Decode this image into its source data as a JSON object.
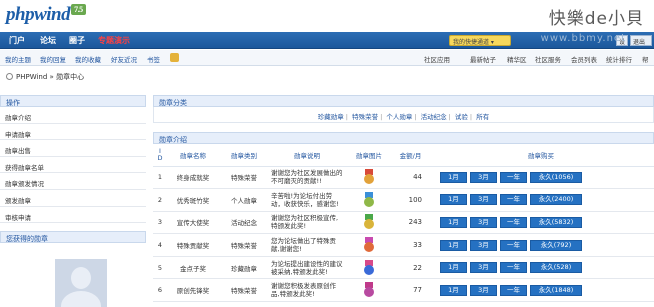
{
  "header": {
    "logo": "phpwind",
    "logo_version": "7.5",
    "watermark": "快樂de小貝",
    "watermark_url": "www.bbmy.net"
  },
  "nav": {
    "items": [
      {
        "label": "门户",
        "color": "#ffffff"
      },
      {
        "label": "论坛",
        "color": "#ffffff"
      },
      {
        "label": "圈子",
        "color": "#ffffff"
      },
      {
        "label": "专题演示",
        "color": "#ff4040"
      }
    ],
    "quick_link": "我的快捷通道 ▾",
    "box1": "设",
    "box2": "退出"
  },
  "subnav": {
    "left": [
      "我的主题",
      "我的回复",
      "我的收藏",
      "好友近况",
      "书签"
    ],
    "right": [
      "社区应用",
      "最新帖子",
      "精华区",
      "社区服务",
      "会员列表",
      "统计排行",
      "帮"
    ]
  },
  "breadcrumb": {
    "site": "PHPWind",
    "separator": "»",
    "current": "勋章中心"
  },
  "sidebar": {
    "title": "操作",
    "items": [
      "勋章介绍",
      "申请勋章",
      "勋章出售",
      "获得勋章名单",
      "勋章颁发情况",
      "颁发勋章",
      "审核申请"
    ],
    "gained_title": "您获得的勋章"
  },
  "category": {
    "title": "勋章分类",
    "items": [
      "珍藏勋章",
      "特殊荣誉",
      "个人勋章",
      "活动纪念",
      "试验",
      "所有"
    ]
  },
  "medal_panel": {
    "title": "勋章介绍",
    "columns": [
      "I D",
      "勋章名称",
      "勋章类别",
      "勋章说明",
      "勋章图片",
      "金额/月",
      "勋章购买"
    ],
    "button_labels": {
      "m1": "1月",
      "m3": "3月",
      "year": "一年"
    },
    "rows": [
      {
        "id": "1",
        "name": "终身成就奖",
        "type": "特殊荣誉",
        "desc": "谢谢您为社区发展做出的不可磨灭的贡献!!",
        "price": "44",
        "forever": "永久(1056)",
        "ribbon": "#d84a3a",
        "disc": "#e2a23a"
      },
      {
        "id": "2",
        "name": "优秀斑竹奖",
        "type": "个人勋章",
        "desc": "辛苦啦!为论坛付出劳动，收获快乐，感谢您!",
        "price": "100",
        "forever": "永久(2400)",
        "ribbon": "#3a8fd8",
        "disc": "#8fb848"
      },
      {
        "id": "3",
        "name": "宣传大使奖",
        "type": "活动纪念",
        "desc": "谢谢您为社区积极宣传,特颁发此奖!",
        "price": "243",
        "forever": "永久(5832)",
        "ribbon": "#4aa84a",
        "disc": "#d9b43a"
      },
      {
        "id": "4",
        "name": "特殊贡献奖",
        "type": "特殊荣誉",
        "desc": "您为论坛做出了特殊贡献,谢谢您!",
        "price": "33",
        "forever": "永久(792)",
        "ribbon": "#c84ab0",
        "disc": "#e06a3a"
      },
      {
        "id": "5",
        "name": "金点子奖",
        "type": "珍藏勋章",
        "desc": "为论坛提出建设性的建议被采纳,特颁发此奖!",
        "price": "22",
        "forever": "永久(528)",
        "ribbon": "#d84a8a",
        "disc": "#3a6ad8"
      },
      {
        "id": "6",
        "name": "原创先锋奖",
        "type": "特殊荣誉",
        "desc": "谢谢您积极发表原创作品,特颁发此奖!",
        "price": "77",
        "forever": "永久(1848)",
        "ribbon": "#c03a8a",
        "disc": "#b84aa0"
      }
    ]
  },
  "colors": {
    "brand": "#1d5ea8",
    "button": "#2571c2",
    "link": "#2457a0"
  }
}
